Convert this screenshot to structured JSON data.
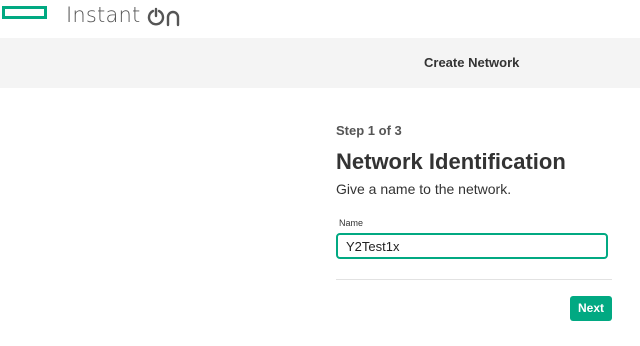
{
  "brand": {
    "name": "Instant",
    "logo_icon": "hpe-green-rectangle",
    "on_icon": "power-on-icon",
    "accent": "#01a982"
  },
  "header": {
    "title": "Create Network"
  },
  "form": {
    "step": "Step 1 of 3",
    "title": "Network Identification",
    "subtitle": "Give a name to the network.",
    "name_label": "Name",
    "name_value": "Y2Test1x"
  },
  "actions": {
    "next_label": "Next"
  }
}
